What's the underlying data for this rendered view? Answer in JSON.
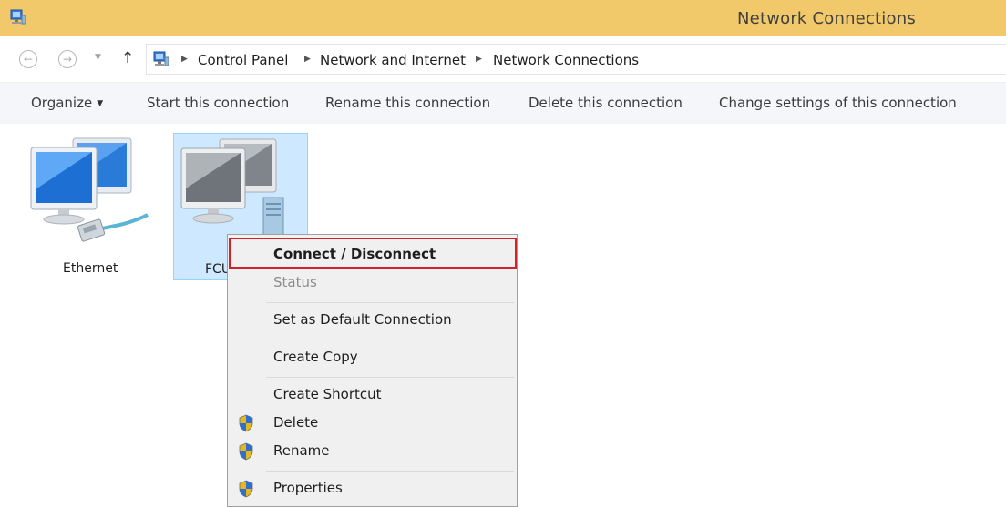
{
  "window": {
    "title": "Network Connections"
  },
  "nav": {
    "back_glyph": "←",
    "forward_glyph": "→",
    "recent_glyph": "▼",
    "up_glyph": "↑"
  },
  "breadcrumbs": [
    "Control Panel",
    "Network and Internet",
    "Network Connections"
  ],
  "toolbar": {
    "organize": "Organize",
    "start": "Start this connection",
    "rename": "Rename this connection",
    "delete": "Delete this connection",
    "change": "Change settings of this connection"
  },
  "items": [
    {
      "label": "Ethernet",
      "icon": "ethernet-monitor-icon",
      "selected": false
    },
    {
      "label": "FCU",
      "icon": "vpn-monitor-icon",
      "selected": true
    }
  ],
  "context_menu": {
    "items": [
      {
        "label": "Connect / Disconnect",
        "bold": true,
        "highlighted": true
      },
      {
        "label": "Status",
        "disabled": true
      },
      {
        "label": "Set as Default Connection"
      },
      {
        "label": "Create Copy"
      },
      {
        "label": "Create Shortcut"
      },
      {
        "label": "Delete",
        "icon": "uac-shield-icon"
      },
      {
        "label": "Rename",
        "icon": "uac-shield-icon"
      },
      {
        "label": "Properties",
        "icon": "uac-shield-icon"
      }
    ]
  },
  "colors": {
    "titlebar": "#f1c86a",
    "selection": "#cde8ff",
    "highlight_border": "#d0222a",
    "menu_bg": "#f0f0f0"
  }
}
